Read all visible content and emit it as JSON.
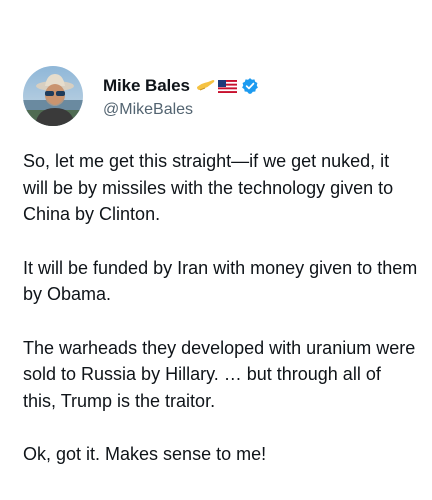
{
  "author": {
    "display_name": "Mike Bales",
    "handle": "@MikeBales",
    "badges": [
      "saluting-hand-icon",
      "us-flag-icon",
      "verified-badge-icon"
    ],
    "colors": {
      "verified": "#1d9bf0",
      "handle": "#536471",
      "text": "#0f1419"
    }
  },
  "tweet": {
    "paragraphs": [
      "So, let me get this straight—if we get nuked, it will be by missiles with the technology given to China by Clinton.",
      "It will be funded by Iran with money given to them by Obama.",
      "The warheads they developed with uranium were sold to Russia by Hillary. … but through all of this, Trump is the traitor.",
      "Ok, got it. Makes sense to me!"
    ]
  }
}
